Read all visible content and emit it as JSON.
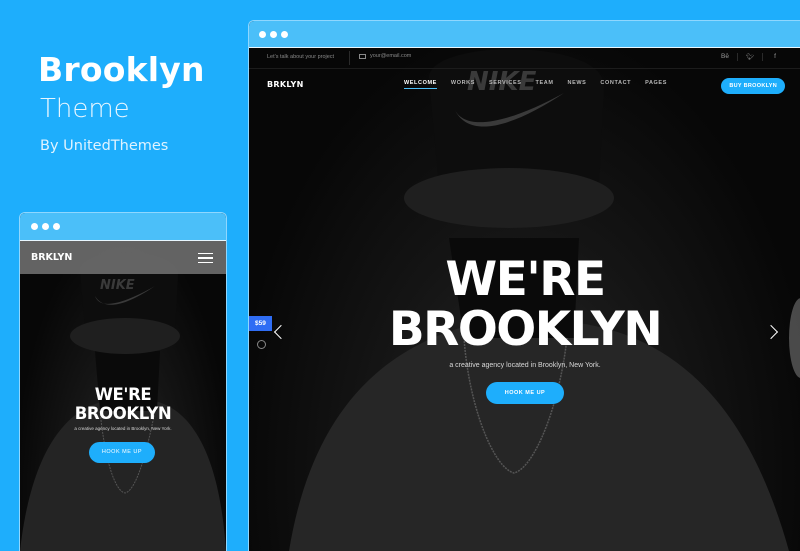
{
  "promo": {
    "title": "Brooklyn",
    "subtitle": "Theme",
    "author": "By UnitedThemes"
  },
  "colors": {
    "background": "#1eaefc",
    "browser_bar": "#4bbff9",
    "accent": "#1eaefc",
    "price_badge": "#2f6df4"
  },
  "desktop": {
    "topbar": {
      "tagline": "Let's talk about your project",
      "email": "your@email.com",
      "social": [
        {
          "icon": "behance-icon",
          "glyph": "Bē"
        },
        {
          "icon": "twitter-icon",
          "glyph": "🐦︎"
        },
        {
          "icon": "facebook-icon",
          "glyph": "f"
        }
      ]
    },
    "nav": {
      "logo": "BRKLYN",
      "menu": [
        "WELCOME",
        "WORKS",
        "SERVICES",
        "TEAM",
        "NEWS",
        "CONTACT",
        "PAGES"
      ],
      "active": "WELCOME",
      "cta": "BUY BROOKLYN"
    },
    "hero": {
      "title_line1": "WE'RE",
      "title_line2": "BROOKLYN",
      "subtitle": "a creative agency located in Brooklyn, New York.",
      "button": "HOOK ME UP"
    },
    "price_badge": "$59",
    "cap_text": "NIKE"
  },
  "mobile": {
    "logo": "BRKLYN",
    "hero": {
      "title_line1": "WE'RE",
      "title_line2": "BROOKLYN",
      "subtitle": "a creative agency located in Brooklyn, New York.",
      "button": "HOOK ME UP"
    },
    "cap_text": "NIKE"
  }
}
